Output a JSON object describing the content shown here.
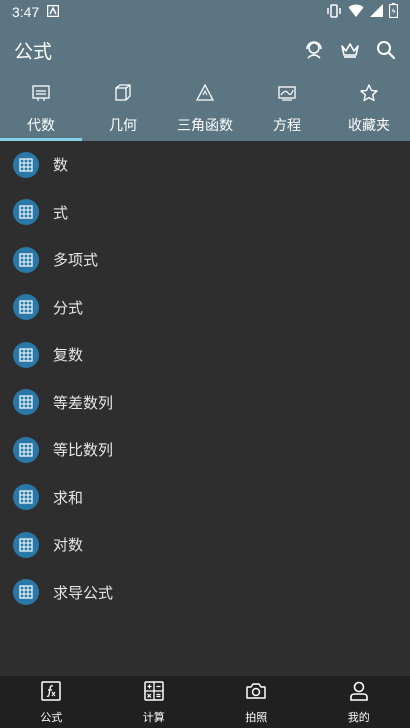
{
  "status_bar": {
    "time": "3:47"
  },
  "app_bar": {
    "title": "公式",
    "actions": [
      "support-icon",
      "crown-icon",
      "search-icon"
    ]
  },
  "tabs": [
    {
      "label": "代数",
      "icon": "algebra-icon",
      "active": true
    },
    {
      "label": "几何",
      "icon": "cube-icon",
      "active": false
    },
    {
      "label": "三角函数",
      "icon": "triangle-icon",
      "active": false
    },
    {
      "label": "方程",
      "icon": "graph-icon",
      "active": false
    },
    {
      "label": "收藏夹",
      "icon": "star-icon",
      "active": false
    }
  ],
  "list": {
    "items": [
      {
        "label": "数"
      },
      {
        "label": "式"
      },
      {
        "label": "多项式"
      },
      {
        "label": "分式"
      },
      {
        "label": "复数"
      },
      {
        "label": "等差数列"
      },
      {
        "label": "等比数列"
      },
      {
        "label": "求和"
      },
      {
        "label": "对数"
      },
      {
        "label": "求导公式"
      }
    ]
  },
  "bottom_nav": [
    {
      "label": "公式",
      "icon": "formula-icon"
    },
    {
      "label": "计算",
      "icon": "calculator-icon"
    },
    {
      "label": "拍照",
      "icon": "camera-icon"
    },
    {
      "label": "我的",
      "icon": "user-icon"
    }
  ],
  "colors": {
    "header_bg": "#5b7682",
    "list_bg": "#2e2e2e",
    "bottom_bg": "#202020",
    "accent": "#86d0e8",
    "item_icon_bg": "#2a78a8"
  }
}
